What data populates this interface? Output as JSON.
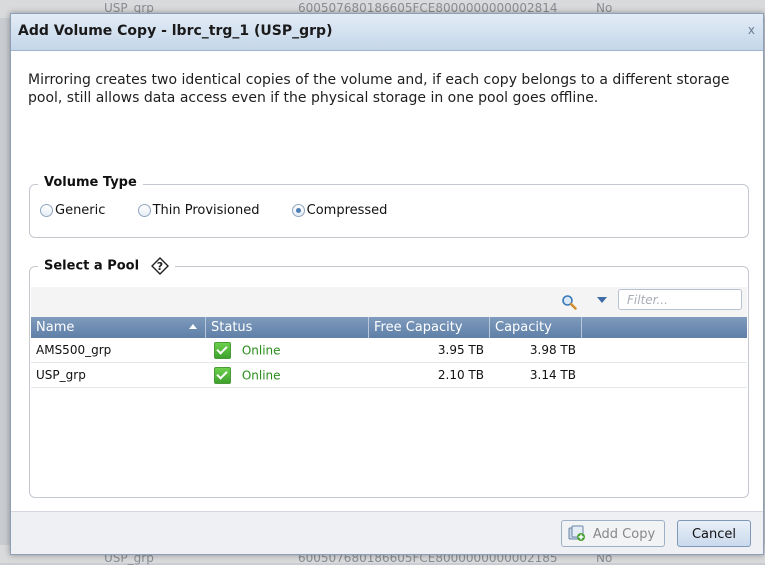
{
  "background": {
    "top_row": [
      "USP_grp",
      "600507680186605FCE8000000000002814",
      "No"
    ],
    "bottom_row": [
      "USP_grp",
      "600507680186605FCE8000000000002185",
      "No"
    ]
  },
  "dialog": {
    "title": "Add Volume Copy - lbrc_trg_1 (USP_grp)",
    "close_label": "x",
    "description": "Mirroring creates two identical copies of the volume and, if each copy belongs to a different storage pool, still allows data access even if the physical storage in one pool goes offline."
  },
  "volume_type": {
    "legend": "Volume Type",
    "options": [
      {
        "label": "Generic",
        "checked": false
      },
      {
        "label": "Thin Provisioned",
        "checked": false
      },
      {
        "label": "Compressed",
        "checked": true
      }
    ]
  },
  "pool": {
    "legend": "Select a Pool",
    "help_icon": "help-icon",
    "filter_placeholder": "Filter...",
    "columns": [
      "Name",
      "Status",
      "Free Capacity",
      "Capacity"
    ],
    "rows": [
      {
        "name": "AMS500_grp",
        "status": "Online",
        "free": "3.95 TB",
        "capacity": "3.98 TB"
      },
      {
        "name": "USP_grp",
        "status": "Online",
        "free": "2.10 TB",
        "capacity": "3.14 TB"
      }
    ]
  },
  "footer": {
    "add_copy_label": "Add Copy",
    "cancel_label": "Cancel"
  },
  "colors": {
    "title_bar": "#c5d6e9",
    "grid_header": "#6f8db4",
    "online_green": "#2a8d1c"
  }
}
